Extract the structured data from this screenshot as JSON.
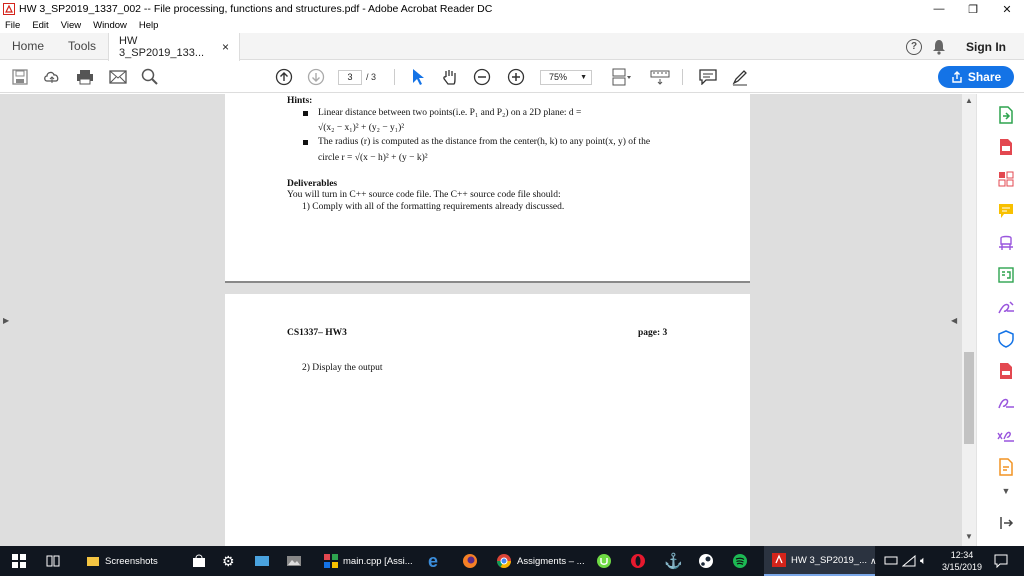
{
  "window": {
    "title": "HW 3_SP2019_1337_002 -- File processing, functions and structures.pdf - Adobe Acrobat Reader DC",
    "minimize": "—",
    "restore": "❐",
    "close": "✕"
  },
  "menu": {
    "items": [
      "File",
      "Edit",
      "View",
      "Window",
      "Help"
    ]
  },
  "tabs": {
    "home": "Home",
    "tools": "Tools",
    "document": "HW 3_SP2019_133...",
    "doc_close": "×",
    "help": "?",
    "sign_in": "Sign In"
  },
  "toolbar": {
    "page_current": "3",
    "page_total": "/ 3",
    "zoom": "75%",
    "share": "Share"
  },
  "page1": {
    "hints_heading": "Hints:",
    "hint1_a": "Linear  distance  between  two  points(i.e.  P₁  and  P₂)  on  a  2D  plane:  d =",
    "hint1_b": "√(x₂ − x₁)² + (y₂ − y₁)²",
    "hint2_a": "The radius (r) is computed as the distance from the center(h, k) to any point(x, y) of the",
    "hint2_b": "circle r = √(x − h)² + (y − k)²",
    "deliverables_heading": "Deliverables",
    "deliverables_text": "You will turn in C++ source code file.  The C++ source code file should:",
    "deliverable1": "1)  Comply with all of the formatting requirements already discussed."
  },
  "page2": {
    "header_left": "CS1337– HW3",
    "header_right": "page:  3",
    "item2": "2)  Display the output"
  },
  "taskbar": {
    "screenshots": "Screenshots",
    "maincpp": "main.cpp [Assi...",
    "assignments": "Assigments – ...",
    "hw3": "HW 3_SP2019_...",
    "time": "12:34",
    "date": "3/15/2019"
  },
  "colors": {
    "accent_blue": "#1473e6",
    "acrobat_red": "#d4241b",
    "taskbar_bg": "#10161f"
  }
}
